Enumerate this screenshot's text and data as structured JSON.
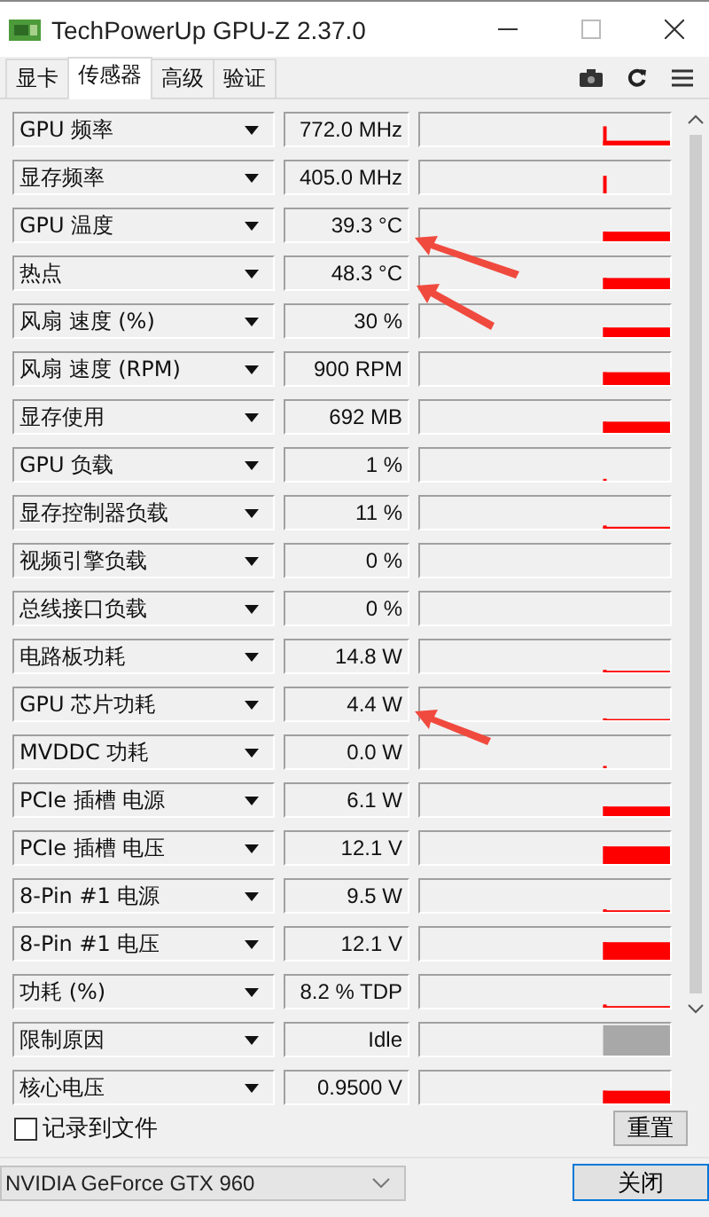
{
  "window": {
    "title": "TechPowerUp GPU-Z 2.37.0"
  },
  "tabs": [
    {
      "label": "显卡",
      "selected": false
    },
    {
      "label": "传感器",
      "selected": true
    },
    {
      "label": "高级",
      "selected": false
    },
    {
      "label": "验证",
      "selected": false
    }
  ],
  "sensors": [
    {
      "name": "GPU 频率",
      "value": "772.0 MHz",
      "kind": "sensor"
    },
    {
      "name": "显存频率",
      "value": "405.0 MHz",
      "kind": "sensor"
    },
    {
      "name": "GPU 温度",
      "value": "39.3 °C",
      "kind": "sensor"
    },
    {
      "name": "热点",
      "value": "48.3 °C",
      "kind": "sensor"
    },
    {
      "name": "风扇 速度 (%)",
      "value": "30 %",
      "kind": "sensor"
    },
    {
      "name": "风扇 速度 (RPM)",
      "value": "900 RPM",
      "kind": "sensor"
    },
    {
      "name": "显存使用",
      "value": "692 MB",
      "kind": "sensor"
    },
    {
      "name": "GPU 负载",
      "value": "1 %",
      "kind": "sensor"
    },
    {
      "name": "显存控制器负载",
      "value": "11 %",
      "kind": "sensor"
    },
    {
      "name": "视频引擎负载",
      "value": "0 %",
      "kind": "sensor"
    },
    {
      "name": "总线接口负载",
      "value": "0 %",
      "kind": "sensor"
    },
    {
      "name": "电路板功耗",
      "value": "14.8 W",
      "kind": "sensor"
    },
    {
      "name": "GPU 芯片功耗",
      "value": "4.4 W",
      "kind": "sensor"
    },
    {
      "name": "MVDDC 功耗",
      "value": "0.0 W",
      "kind": "sensor"
    },
    {
      "name": "PCIe 插槽 电源",
      "value": "6.1 W",
      "kind": "sensor"
    },
    {
      "name": "PCIe 插槽 电压",
      "value": "12.1 V",
      "kind": "sensor"
    },
    {
      "name": "8-Pin #1 电源",
      "value": "9.5 W",
      "kind": "sensor"
    },
    {
      "name": "8-Pin #1 电压",
      "value": "12.1 V",
      "kind": "sensor"
    },
    {
      "name": "功耗 (%)",
      "value": "8.2 % TDP",
      "kind": "sensor"
    },
    {
      "name": "限制原因",
      "value": "Idle",
      "kind": "status"
    },
    {
      "name": "核心电压",
      "value": "0.9500 V",
      "kind": "sensor"
    }
  ],
  "log_to_file": {
    "label": "记录到文件",
    "checked": false
  },
  "reset_button": "重置",
  "gpu_select": {
    "value": "NVIDIA GeForce GTX 960"
  },
  "close_button": "关闭"
}
